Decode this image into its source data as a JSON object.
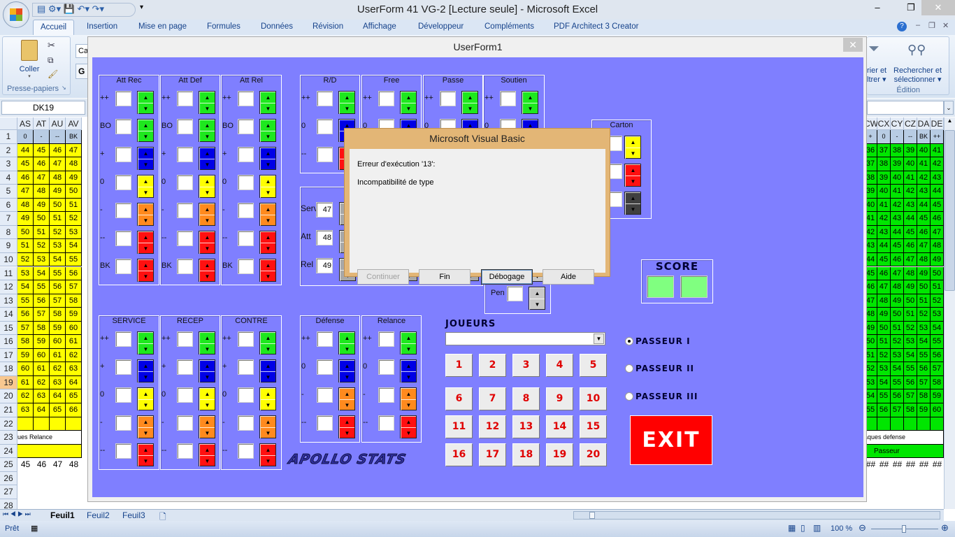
{
  "window": {
    "title": "UserForm 41 VG-2  [Lecture seule] - Microsoft Excel",
    "minimize": "–",
    "restore": "❐",
    "close": "✕"
  },
  "ribbon": {
    "tabs": [
      "Accueil",
      "Insertion",
      "Mise en page",
      "Formules",
      "Données",
      "Révision",
      "Affichage",
      "Développeur",
      "Compléments",
      "PDF Architect 3 Creator"
    ],
    "paste_label": "Coller",
    "clipboard_group": "Presse-papiers",
    "font_partial": "Ca",
    "bold_partial": "G",
    "sort_filter_line1": "rier et",
    "sort_filter_line2": "ltrer ▾",
    "find_select_line1": "Rechercher et",
    "find_select_line2": "sélectionner ▾",
    "edit_group": "Édition"
  },
  "formula_bar": {
    "name_box": "DK19"
  },
  "sheet_left": {
    "columns": [
      "AS",
      "AT",
      "AU",
      "AV"
    ],
    "header_row": [
      "0",
      "-",
      "--",
      "BK"
    ],
    "rows": [
      [
        "44",
        "45",
        "46",
        "47"
      ],
      [
        "45",
        "46",
        "47",
        "48"
      ],
      [
        "46",
        "47",
        "48",
        "49"
      ],
      [
        "47",
        "48",
        "49",
        "50"
      ],
      [
        "48",
        "49",
        "50",
        "51"
      ],
      [
        "49",
        "50",
        "51",
        "52"
      ],
      [
        "50",
        "51",
        "52",
        "53"
      ],
      [
        "51",
        "52",
        "53",
        "54"
      ],
      [
        "52",
        "53",
        "54",
        "55"
      ],
      [
        "53",
        "54",
        "55",
        "56"
      ],
      [
        "54",
        "55",
        "56",
        "57"
      ],
      [
        "55",
        "56",
        "57",
        "58"
      ],
      [
        "56",
        "57",
        "58",
        "59"
      ],
      [
        "57",
        "58",
        "59",
        "60"
      ],
      [
        "58",
        "59",
        "60",
        "61"
      ],
      [
        "59",
        "60",
        "61",
        "62"
      ],
      [
        "60",
        "61",
        "62",
        "63"
      ],
      [
        "61",
        "62",
        "63",
        "64"
      ],
      [
        "62",
        "63",
        "64",
        "65"
      ],
      [
        "63",
        "64",
        "65",
        "66"
      ]
    ],
    "row23_text": "ues Relance",
    "row25": [
      "45",
      "46",
      "47",
      "48"
    ]
  },
  "sheet_right": {
    "columns": [
      "CW",
      "CX",
      "CY",
      "CZ",
      "DA",
      "DE"
    ],
    "header_row": [
      "+",
      "0",
      "-",
      "--",
      "BK",
      "++"
    ],
    "rows": [
      [
        "36",
        "37",
        "38",
        "39",
        "40",
        "41"
      ],
      [
        "37",
        "38",
        "39",
        "40",
        "41",
        "42"
      ],
      [
        "38",
        "39",
        "40",
        "41",
        "42",
        "43"
      ],
      [
        "39",
        "40",
        "41",
        "42",
        "43",
        "44"
      ],
      [
        "40",
        "41",
        "42",
        "43",
        "44",
        "45"
      ],
      [
        "41",
        "42",
        "43",
        "44",
        "45",
        "46"
      ],
      [
        "42",
        "43",
        "44",
        "45",
        "46",
        "47"
      ],
      [
        "43",
        "44",
        "45",
        "46",
        "47",
        "48"
      ],
      [
        "44",
        "45",
        "46",
        "47",
        "48",
        "49"
      ],
      [
        "45",
        "46",
        "47",
        "48",
        "49",
        "50"
      ],
      [
        "46",
        "47",
        "48",
        "49",
        "50",
        "51"
      ],
      [
        "47",
        "48",
        "49",
        "50",
        "51",
        "52"
      ],
      [
        "48",
        "49",
        "50",
        "51",
        "52",
        "53"
      ],
      [
        "49",
        "50",
        "51",
        "52",
        "53",
        "54"
      ],
      [
        "50",
        "51",
        "52",
        "53",
        "54",
        "55"
      ],
      [
        "51",
        "52",
        "53",
        "54",
        "55",
        "56"
      ],
      [
        "52",
        "53",
        "54",
        "55",
        "56",
        "57"
      ],
      [
        "53",
        "54",
        "55",
        "56",
        "57",
        "58"
      ],
      [
        "54",
        "55",
        "56",
        "57",
        "58",
        "59"
      ],
      [
        "55",
        "56",
        "57",
        "58",
        "59",
        "60"
      ]
    ],
    "row23_text": "aques defense",
    "row24_text": "Passeur",
    "row25": [
      "##",
      "##",
      "##",
      "##",
      "##",
      "##"
    ]
  },
  "row_numbers": [
    "1",
    "2",
    "3",
    "4",
    "5",
    "6",
    "7",
    "8",
    "9",
    "10",
    "11",
    "12",
    "13",
    "14",
    "15",
    "16",
    "17",
    "18",
    "19",
    "20",
    "21",
    "22",
    "23",
    "24",
    "25",
    "26",
    "27",
    "28"
  ],
  "colors": {
    "green": "#1ee81e",
    "blue": "#0000e6",
    "yellow": "#ffff00",
    "orange": "#ff8a1e",
    "red": "#ff1010",
    "gray": "#a8a8a8",
    "dark": "#404040",
    "light": "#c8c8c8",
    "form_bg": "#7f7fff",
    "sheet_yellow": "#ffff00",
    "sheet_green": "#00e600"
  },
  "userform": {
    "title": "UserForm1",
    "close": "✕",
    "frames": [
      {
        "title": "Att Rec",
        "rows": [
          {
            "label": "++",
            "color": "green"
          },
          {
            "label": "BO",
            "color": "green"
          },
          {
            "label": "+",
            "color": "blue"
          },
          {
            "label": "0",
            "color": "yellow"
          },
          {
            "label": "-",
            "color": "orange"
          },
          {
            "label": "--",
            "color": "red"
          },
          {
            "label": "BK",
            "color": "red"
          }
        ]
      },
      {
        "title": "Att Def",
        "rows": [
          {
            "label": "++",
            "color": "green"
          },
          {
            "label": "BO",
            "color": "green"
          },
          {
            "label": "+",
            "color": "blue"
          },
          {
            "label": "0",
            "color": "yellow"
          },
          {
            "label": "-",
            "color": "orange"
          },
          {
            "label": "--",
            "color": "red"
          },
          {
            "label": "BK",
            "color": "red"
          }
        ]
      },
      {
        "title": "Att Rel",
        "rows": [
          {
            "label": "++",
            "color": "green"
          },
          {
            "label": "BO",
            "color": "green"
          },
          {
            "label": "+",
            "color": "blue"
          },
          {
            "label": "0",
            "color": "yellow"
          },
          {
            "label": "-",
            "color": "orange"
          },
          {
            "label": "--",
            "color": "red"
          },
          {
            "label": "BK",
            "color": "red"
          }
        ]
      },
      {
        "title": "R/D",
        "rows": [
          {
            "label": "++",
            "color": "green"
          },
          {
            "label": "0",
            "color": "blue"
          },
          {
            "label": "--",
            "color": "red"
          }
        ]
      },
      {
        "title": "Free",
        "rows": [
          {
            "label": "++",
            "color": "green"
          },
          {
            "label": "0",
            "color": "blue"
          },
          {
            "label": "--",
            "color": "red"
          }
        ]
      },
      {
        "title": "Passe",
        "rows": [
          {
            "label": "++",
            "color": "green"
          },
          {
            "label": "0",
            "color": "blue"
          },
          {
            "label": "--",
            "color": "red"
          }
        ]
      },
      {
        "title": "Soutien",
        "rows": [
          {
            "label": "++",
            "color": "green"
          },
          {
            "label": "0",
            "color": "blue"
          },
          {
            "label": "--",
            "color": "red"
          }
        ]
      },
      {
        "title": "SERVICE",
        "rows": [
          {
            "label": "++",
            "color": "green"
          },
          {
            "label": "+",
            "color": "blue"
          },
          {
            "label": "0",
            "color": "yellow"
          },
          {
            "label": "-",
            "color": "orange"
          },
          {
            "label": "--",
            "color": "red"
          }
        ]
      },
      {
        "title": "RECEP",
        "rows": [
          {
            "label": "++",
            "color": "green"
          },
          {
            "label": "+",
            "color": "blue"
          },
          {
            "label": "0",
            "color": "yellow"
          },
          {
            "label": "-",
            "color": "orange"
          },
          {
            "label": "--",
            "color": "red"
          }
        ]
      },
      {
        "title": "CONTRE",
        "rows": [
          {
            "label": "++",
            "color": "green"
          },
          {
            "label": "+",
            "color": "blue"
          },
          {
            "label": "0",
            "color": "yellow"
          },
          {
            "label": "-",
            "color": "orange"
          },
          {
            "label": "--",
            "color": "red"
          }
        ]
      },
      {
        "title": "Défense",
        "rows": [
          {
            "label": "++",
            "color": "green"
          },
          {
            "label": "0",
            "color": "blue"
          },
          {
            "label": "-",
            "color": "orange"
          },
          {
            "label": "--",
            "color": "red"
          }
        ]
      },
      {
        "title": "Relance",
        "rows": [
          {
            "label": "++",
            "color": "green"
          },
          {
            "label": "0",
            "color": "blue"
          },
          {
            "label": "-",
            "color": "orange"
          },
          {
            "label": "--",
            "color": "red"
          }
        ]
      }
    ],
    "carton": {
      "title": "Carton",
      "colors": [
        "yellow",
        "red",
        "dark"
      ]
    },
    "serv_group": {
      "rows": [
        {
          "label": "Serv",
          "value": "47"
        },
        {
          "label": "Att",
          "value": "48"
        },
        {
          "label": "Rel",
          "value": "49"
        }
      ]
    },
    "pen": {
      "label": "Pen",
      "value": ""
    },
    "score": {
      "title": "SCORE",
      "home": "",
      "away": ""
    },
    "players": {
      "label": "JOUEURS",
      "combo_value": "",
      "numbers": [
        "1",
        "2",
        "3",
        "4",
        "5",
        "6",
        "7",
        "8",
        "9",
        "10",
        "11",
        "12",
        "13",
        "14",
        "15",
        "16",
        "17",
        "18",
        "19",
        "20"
      ]
    },
    "setters": [
      {
        "label": "PASSEUR I",
        "checked": true
      },
      {
        "label": "PASSEUR II",
        "checked": false
      },
      {
        "label": "PASSEUR III",
        "checked": false
      }
    ],
    "exit_label": "EXIT",
    "logo_text": "APOLLO STATS"
  },
  "dialog": {
    "title": "Microsoft Visual Basic",
    "error_line": "Erreur d'exécution '13':",
    "message": "Incompatibilité de type",
    "buttons": {
      "continue": "Continuer",
      "end": "Fin",
      "debug": "Débogage",
      "help": "Aide"
    }
  },
  "sheet_tabs": [
    "Feuil1",
    "Feuil2",
    "Feuil3"
  ],
  "status": {
    "ready": "Prêt",
    "zoom": "100 %"
  }
}
